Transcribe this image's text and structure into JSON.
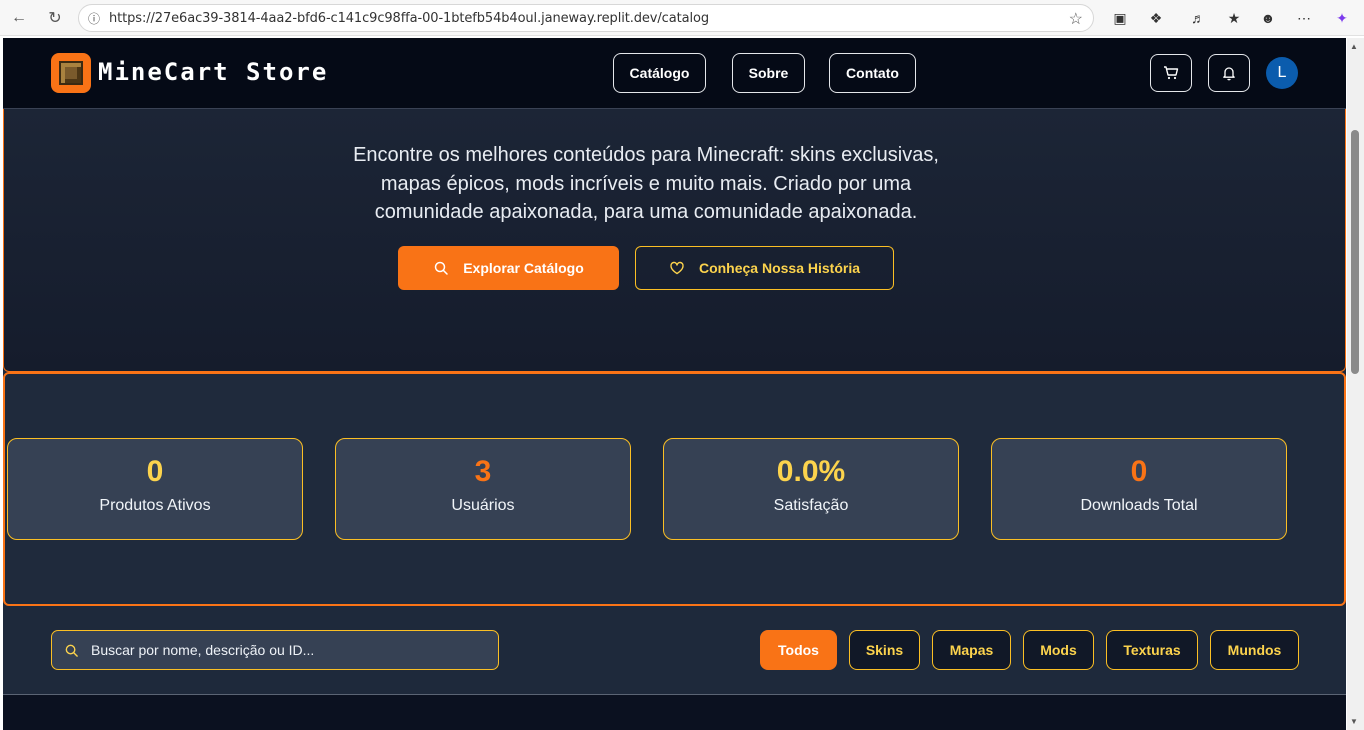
{
  "browser": {
    "url": "https://27e6ac39-3814-4aa2-bfd6-c141c9c98ffa-00-1btefb54b4oul.janeway.replit.dev/catalog"
  },
  "header": {
    "brand": "MineCart Store",
    "nav": [
      "Catálogo",
      "Sobre",
      "Contato"
    ],
    "avatar_initial": "L"
  },
  "hero": {
    "text": "Encontre os melhores conteúdos para Minecraft: skins exclusivas, mapas épicos, mods incríveis e muito mais. Criado por uma comunidade apaixonada, para uma comunidade apaixonada.",
    "primary_button": "Explorar Catálogo",
    "secondary_button": "Conheça Nossa História"
  },
  "stats": [
    {
      "value": "0",
      "label": "Produtos Ativos",
      "color": "#fcd34d"
    },
    {
      "value": "3",
      "label": "Usuários",
      "color": "#f97316"
    },
    {
      "value": "0.0%",
      "label": "Satisfação",
      "color": "#fcd34d"
    },
    {
      "value": "0",
      "label": "Downloads Total",
      "color": "#f97316"
    }
  ],
  "filters": {
    "search_placeholder": "Buscar por nome, descrição ou ID...",
    "categories": [
      "Todos",
      "Skins",
      "Mapas",
      "Mods",
      "Texturas",
      "Mundos"
    ],
    "active": "Todos"
  },
  "colors": {
    "accent": "#f97316",
    "gold": "#fbbf24"
  }
}
